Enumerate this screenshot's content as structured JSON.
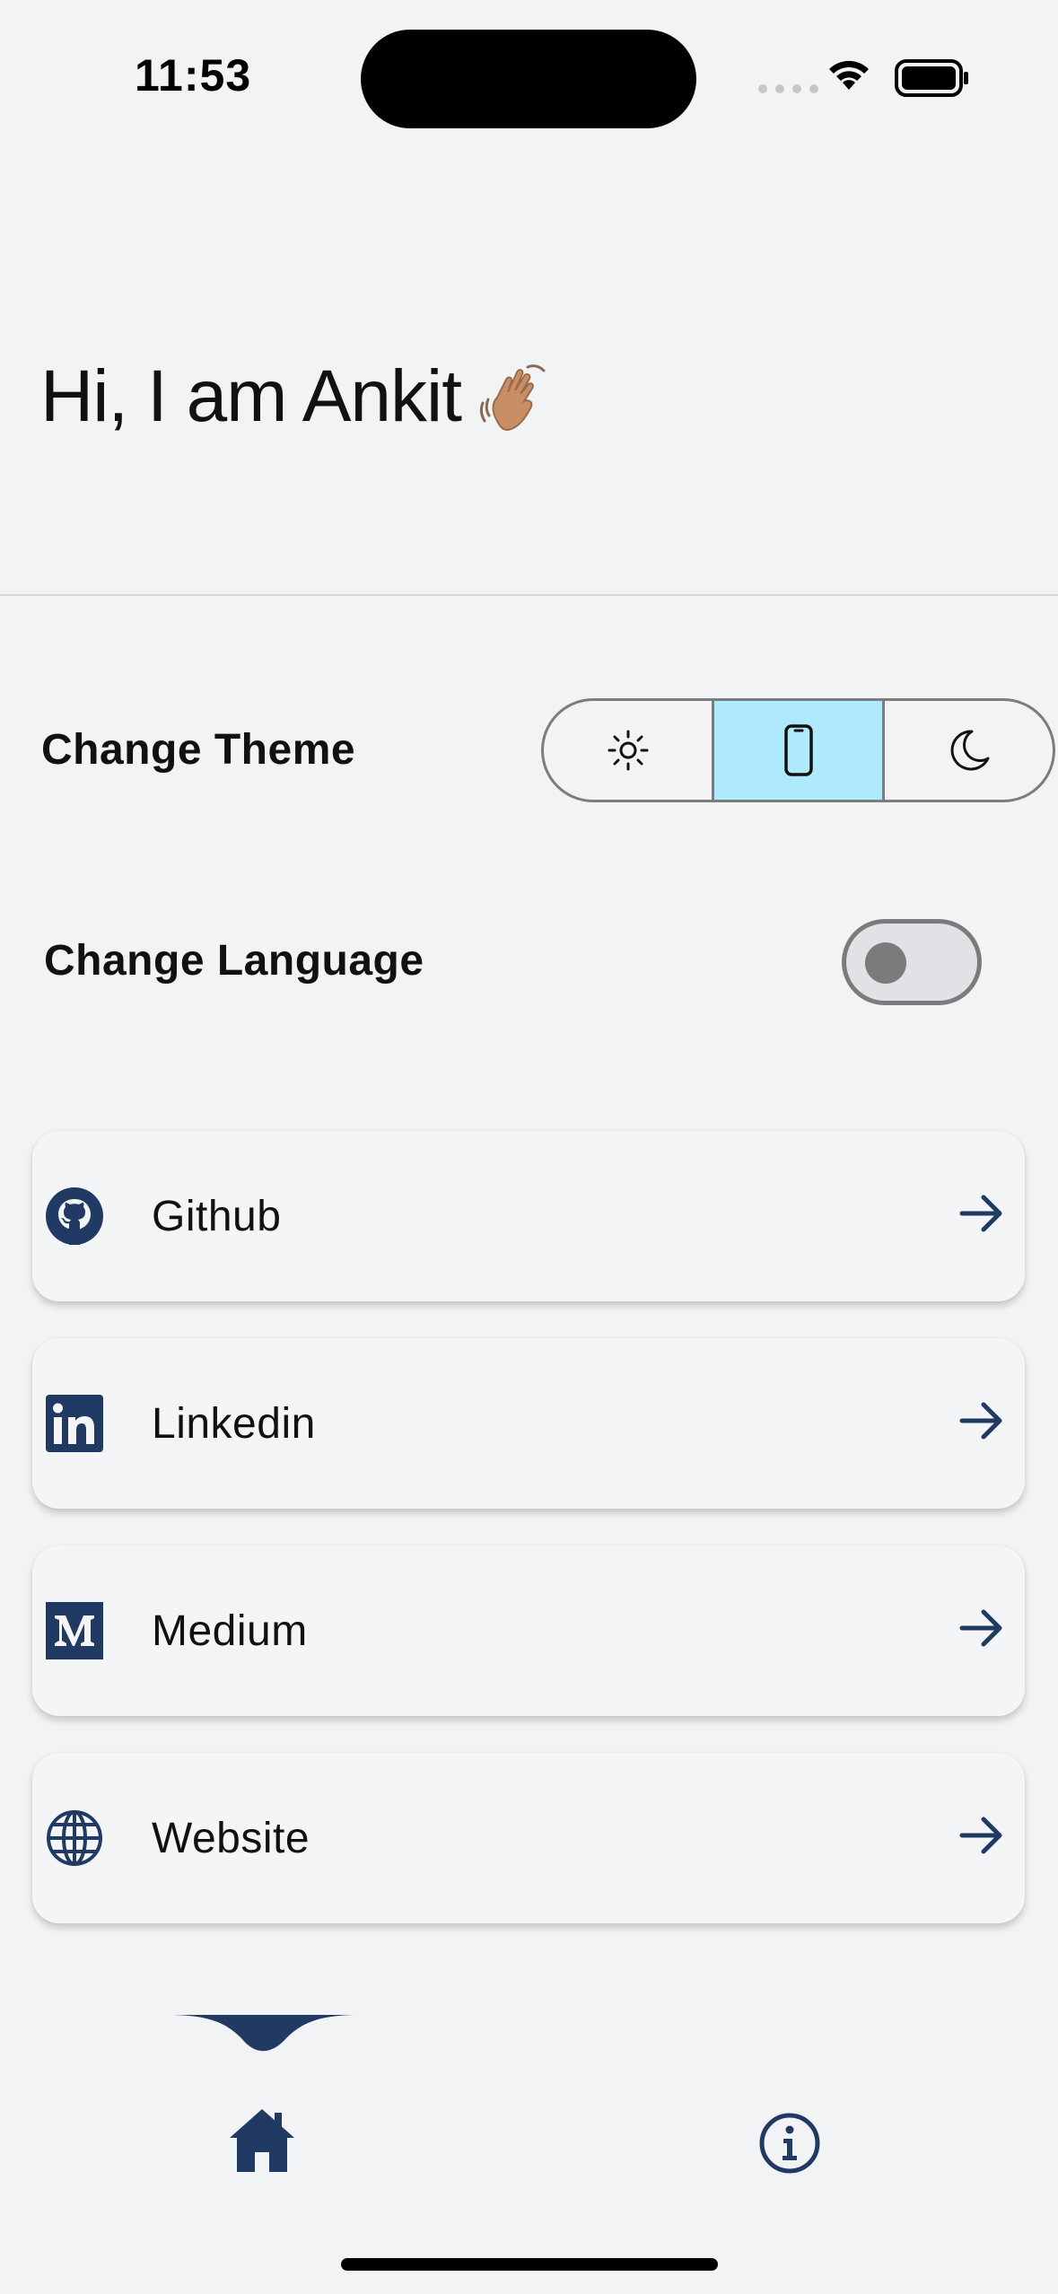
{
  "status_bar": {
    "time": "11:53"
  },
  "header": {
    "greeting": "Hi, I am Ankit",
    "greeting_emoji": "👋🏽"
  },
  "settings": {
    "theme_label": "Change Theme",
    "theme_options": [
      {
        "icon": "sun-icon",
        "selected": false
      },
      {
        "icon": "phone-icon",
        "selected": true
      },
      {
        "icon": "moon-icon",
        "selected": false
      }
    ],
    "language_label": "Change Language",
    "language_toggle_on": false
  },
  "links": [
    {
      "label": "Github",
      "icon": "github-icon"
    },
    {
      "label": "Linkedin",
      "icon": "linkedin-icon"
    },
    {
      "label": "Medium",
      "icon": "medium-icon"
    },
    {
      "label": "Website",
      "icon": "globe-icon"
    }
  ],
  "bottom_nav": {
    "items": [
      {
        "icon": "home-icon",
        "active": true
      },
      {
        "icon": "info-icon",
        "active": false
      }
    ]
  },
  "colors": {
    "background": "#f2f3f5",
    "accent_navy": "#213a63",
    "theme_selected": "#aeeafc",
    "text": "#111111"
  }
}
